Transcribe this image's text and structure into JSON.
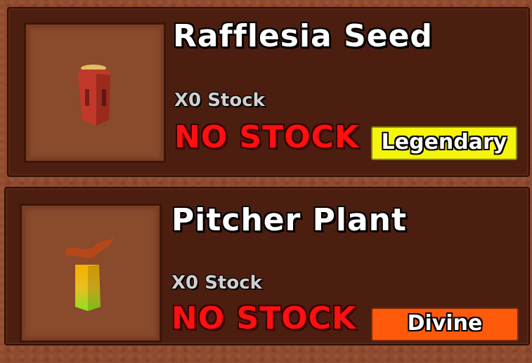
{
  "items": [
    {
      "name": "Rafflesia Seed",
      "stock_text": "X0 Stock",
      "status_text": "NO STOCK",
      "rarity": "Legendary",
      "rarity_color": "#f4f40c",
      "icon": "rafflesia-seed-pack-icon"
    },
    {
      "name": "Pitcher Plant",
      "stock_text": "X0 Stock",
      "status_text": "NO STOCK",
      "rarity": "Divine",
      "rarity_color": "#ff5a0a",
      "icon": "pitcher-plant-seed-pack-icon"
    }
  ]
}
